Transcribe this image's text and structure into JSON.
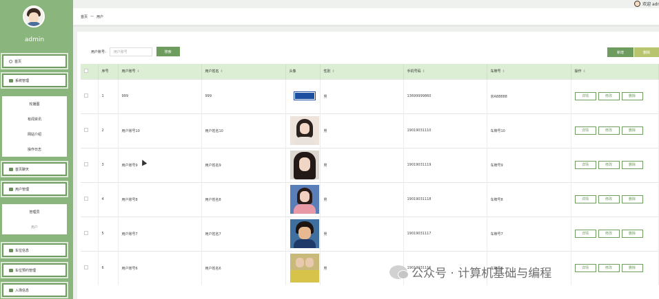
{
  "header": {
    "welcome": "欢迎 adr"
  },
  "sidebar": {
    "admin": "admin",
    "items": [
      {
        "label": "首页"
      },
      {
        "label": "系统管理"
      },
      {
        "label": "首页聊天"
      },
      {
        "label": "用户管理"
      },
      {
        "label": "车位信息"
      },
      {
        "label": "车位预约管理"
      },
      {
        "label": "入场信息"
      }
    ],
    "system_sub": [
      "轮播图",
      "有闻资讯",
      "网站介绍",
      "操作日志"
    ],
    "user_sub": [
      "管理员",
      "用户"
    ]
  },
  "breadcrumb": {
    "home": "首页",
    "sep": "—",
    "current": "用户"
  },
  "search": {
    "label": "用户账号:",
    "placeholder": "用户账号",
    "button": "搜索"
  },
  "toolbar": {
    "add": "新增",
    "delete": "删除"
  },
  "table": {
    "headers": [
      "序号",
      "用户账号",
      "用户姓名",
      "头像",
      "性别",
      "手机号码",
      "车牌号",
      "操作"
    ],
    "actions": [
      "详情",
      "修改",
      "删除"
    ],
    "rows": [
      {
        "no": "1",
        "account": "999",
        "name": "999",
        "gender": "男",
        "phone": "13699999860",
        "plate": "京A88888"
      },
      {
        "no": "2",
        "account": "用户账号10",
        "name": "用户姓名10",
        "gender": "男",
        "phone": "19019031110",
        "plate": "车牌号10"
      },
      {
        "no": "3",
        "account": "用户账号9",
        "name": "用户姓名9",
        "gender": "男",
        "phone": "19019031119",
        "plate": "车牌号9"
      },
      {
        "no": "4",
        "account": "用户账号8",
        "name": "用户姓名8",
        "gender": "男",
        "phone": "19019031118",
        "plate": "车牌号8"
      },
      {
        "no": "5",
        "account": "用户账号7",
        "name": "用户姓名7",
        "gender": "男",
        "phone": "19019031117",
        "plate": "车牌号7"
      },
      {
        "no": "6",
        "account": "用户账号6",
        "name": "用户姓名6",
        "gender": "男",
        "phone": "19019031116",
        "plate": "车牌号6"
      }
    ]
  },
  "watermark": "公众号 · 计算机基础与编程",
  "colors": {
    "sidebar": "#8ab57c",
    "primary": "#6e9c5f",
    "delete": "#b8c46e",
    "header_row": "#dceed3"
  }
}
